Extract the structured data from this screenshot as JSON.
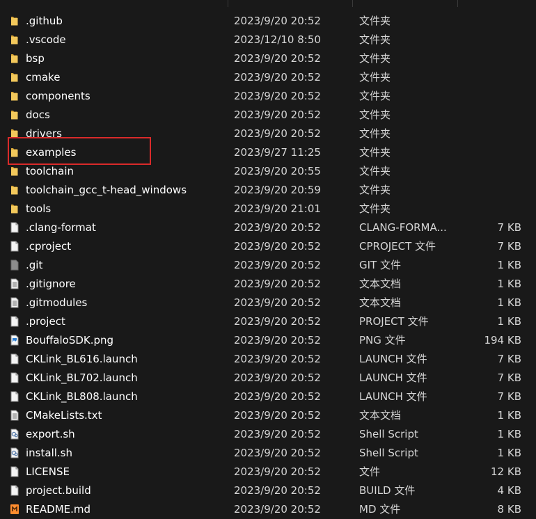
{
  "colors": {
    "background": "#191919",
    "folder": "#e6b84a",
    "highlight_border": "#d92a2a"
  },
  "files": [
    {
      "name": ".github",
      "date": "2023/9/20 20:52",
      "type": "文件夹",
      "size": "",
      "icon": "folder-icon"
    },
    {
      "name": ".vscode",
      "date": "2023/12/10 8:50",
      "type": "文件夹",
      "size": "",
      "icon": "folder-icon"
    },
    {
      "name": "bsp",
      "date": "2023/9/20 20:52",
      "type": "文件夹",
      "size": "",
      "icon": "folder-icon"
    },
    {
      "name": "cmake",
      "date": "2023/9/20 20:52",
      "type": "文件夹",
      "size": "",
      "icon": "folder-icon"
    },
    {
      "name": "components",
      "date": "2023/9/20 20:52",
      "type": "文件夹",
      "size": "",
      "icon": "folder-icon"
    },
    {
      "name": "docs",
      "date": "2023/9/20 20:52",
      "type": "文件夹",
      "size": "",
      "icon": "folder-icon"
    },
    {
      "name": "drivers",
      "date": "2023/9/20 20:52",
      "type": "文件夹",
      "size": "",
      "icon": "folder-icon"
    },
    {
      "name": "examples",
      "date": "2023/9/27 11:25",
      "type": "文件夹",
      "size": "",
      "icon": "folder-icon"
    },
    {
      "name": "toolchain",
      "date": "2023/9/20 20:55",
      "type": "文件夹",
      "size": "",
      "icon": "folder-icon"
    },
    {
      "name": "toolchain_gcc_t-head_windows",
      "date": "2023/9/20 20:59",
      "type": "文件夹",
      "size": "",
      "icon": "folder-icon"
    },
    {
      "name": "tools",
      "date": "2023/9/20 21:01",
      "type": "文件夹",
      "size": "",
      "icon": "folder-icon"
    },
    {
      "name": ".clang-format",
      "date": "2023/9/20 20:52",
      "type": "CLANG-FORMA...",
      "size": "7 KB",
      "icon": "blank-file-icon"
    },
    {
      "name": ".cproject",
      "date": "2023/9/20 20:52",
      "type": "CPROJECT 文件",
      "size": "7 KB",
      "icon": "blank-file-icon"
    },
    {
      "name": ".git",
      "date": "2023/9/20 20:52",
      "type": "GIT 文件",
      "size": "1 KB",
      "icon": "git-file-icon"
    },
    {
      "name": ".gitignore",
      "date": "2023/9/20 20:52",
      "type": "文本文档",
      "size": "1 KB",
      "icon": "text-file-icon"
    },
    {
      "name": ".gitmodules",
      "date": "2023/9/20 20:52",
      "type": "文本文档",
      "size": "1 KB",
      "icon": "text-file-icon"
    },
    {
      "name": ".project",
      "date": "2023/9/20 20:52",
      "type": "PROJECT 文件",
      "size": "1 KB",
      "icon": "blank-file-icon"
    },
    {
      "name": "BouffaloSDK.png",
      "date": "2023/9/20 20:52",
      "type": "PNG 文件",
      "size": "194 KB",
      "icon": "image-file-icon"
    },
    {
      "name": "CKLink_BL616.launch",
      "date": "2023/9/20 20:52",
      "type": "LAUNCH 文件",
      "size": "7 KB",
      "icon": "blank-file-icon"
    },
    {
      "name": "CKLink_BL702.launch",
      "date": "2023/9/20 20:52",
      "type": "LAUNCH 文件",
      "size": "7 KB",
      "icon": "blank-file-icon"
    },
    {
      "name": "CKLink_BL808.launch",
      "date": "2023/9/20 20:52",
      "type": "LAUNCH 文件",
      "size": "7 KB",
      "icon": "blank-file-icon"
    },
    {
      "name": "CMakeLists.txt",
      "date": "2023/9/20 20:52",
      "type": "文本文档",
      "size": "1 KB",
      "icon": "text-file-icon"
    },
    {
      "name": "export.sh",
      "date": "2023/9/20 20:52",
      "type": "Shell Script",
      "size": "1 KB",
      "icon": "shell-script-icon"
    },
    {
      "name": "install.sh",
      "date": "2023/9/20 20:52",
      "type": "Shell Script",
      "size": "1 KB",
      "icon": "shell-script-icon"
    },
    {
      "name": "LICENSE",
      "date": "2023/9/20 20:52",
      "type": "文件",
      "size": "12 KB",
      "icon": "blank-file-icon"
    },
    {
      "name": "project.build",
      "date": "2023/9/20 20:52",
      "type": "BUILD 文件",
      "size": "4 KB",
      "icon": "blank-file-icon"
    },
    {
      "name": "README.md",
      "date": "2023/9/20 20:52",
      "type": "MD 文件",
      "size": "8 KB",
      "icon": "markdown-file-icon"
    }
  ]
}
